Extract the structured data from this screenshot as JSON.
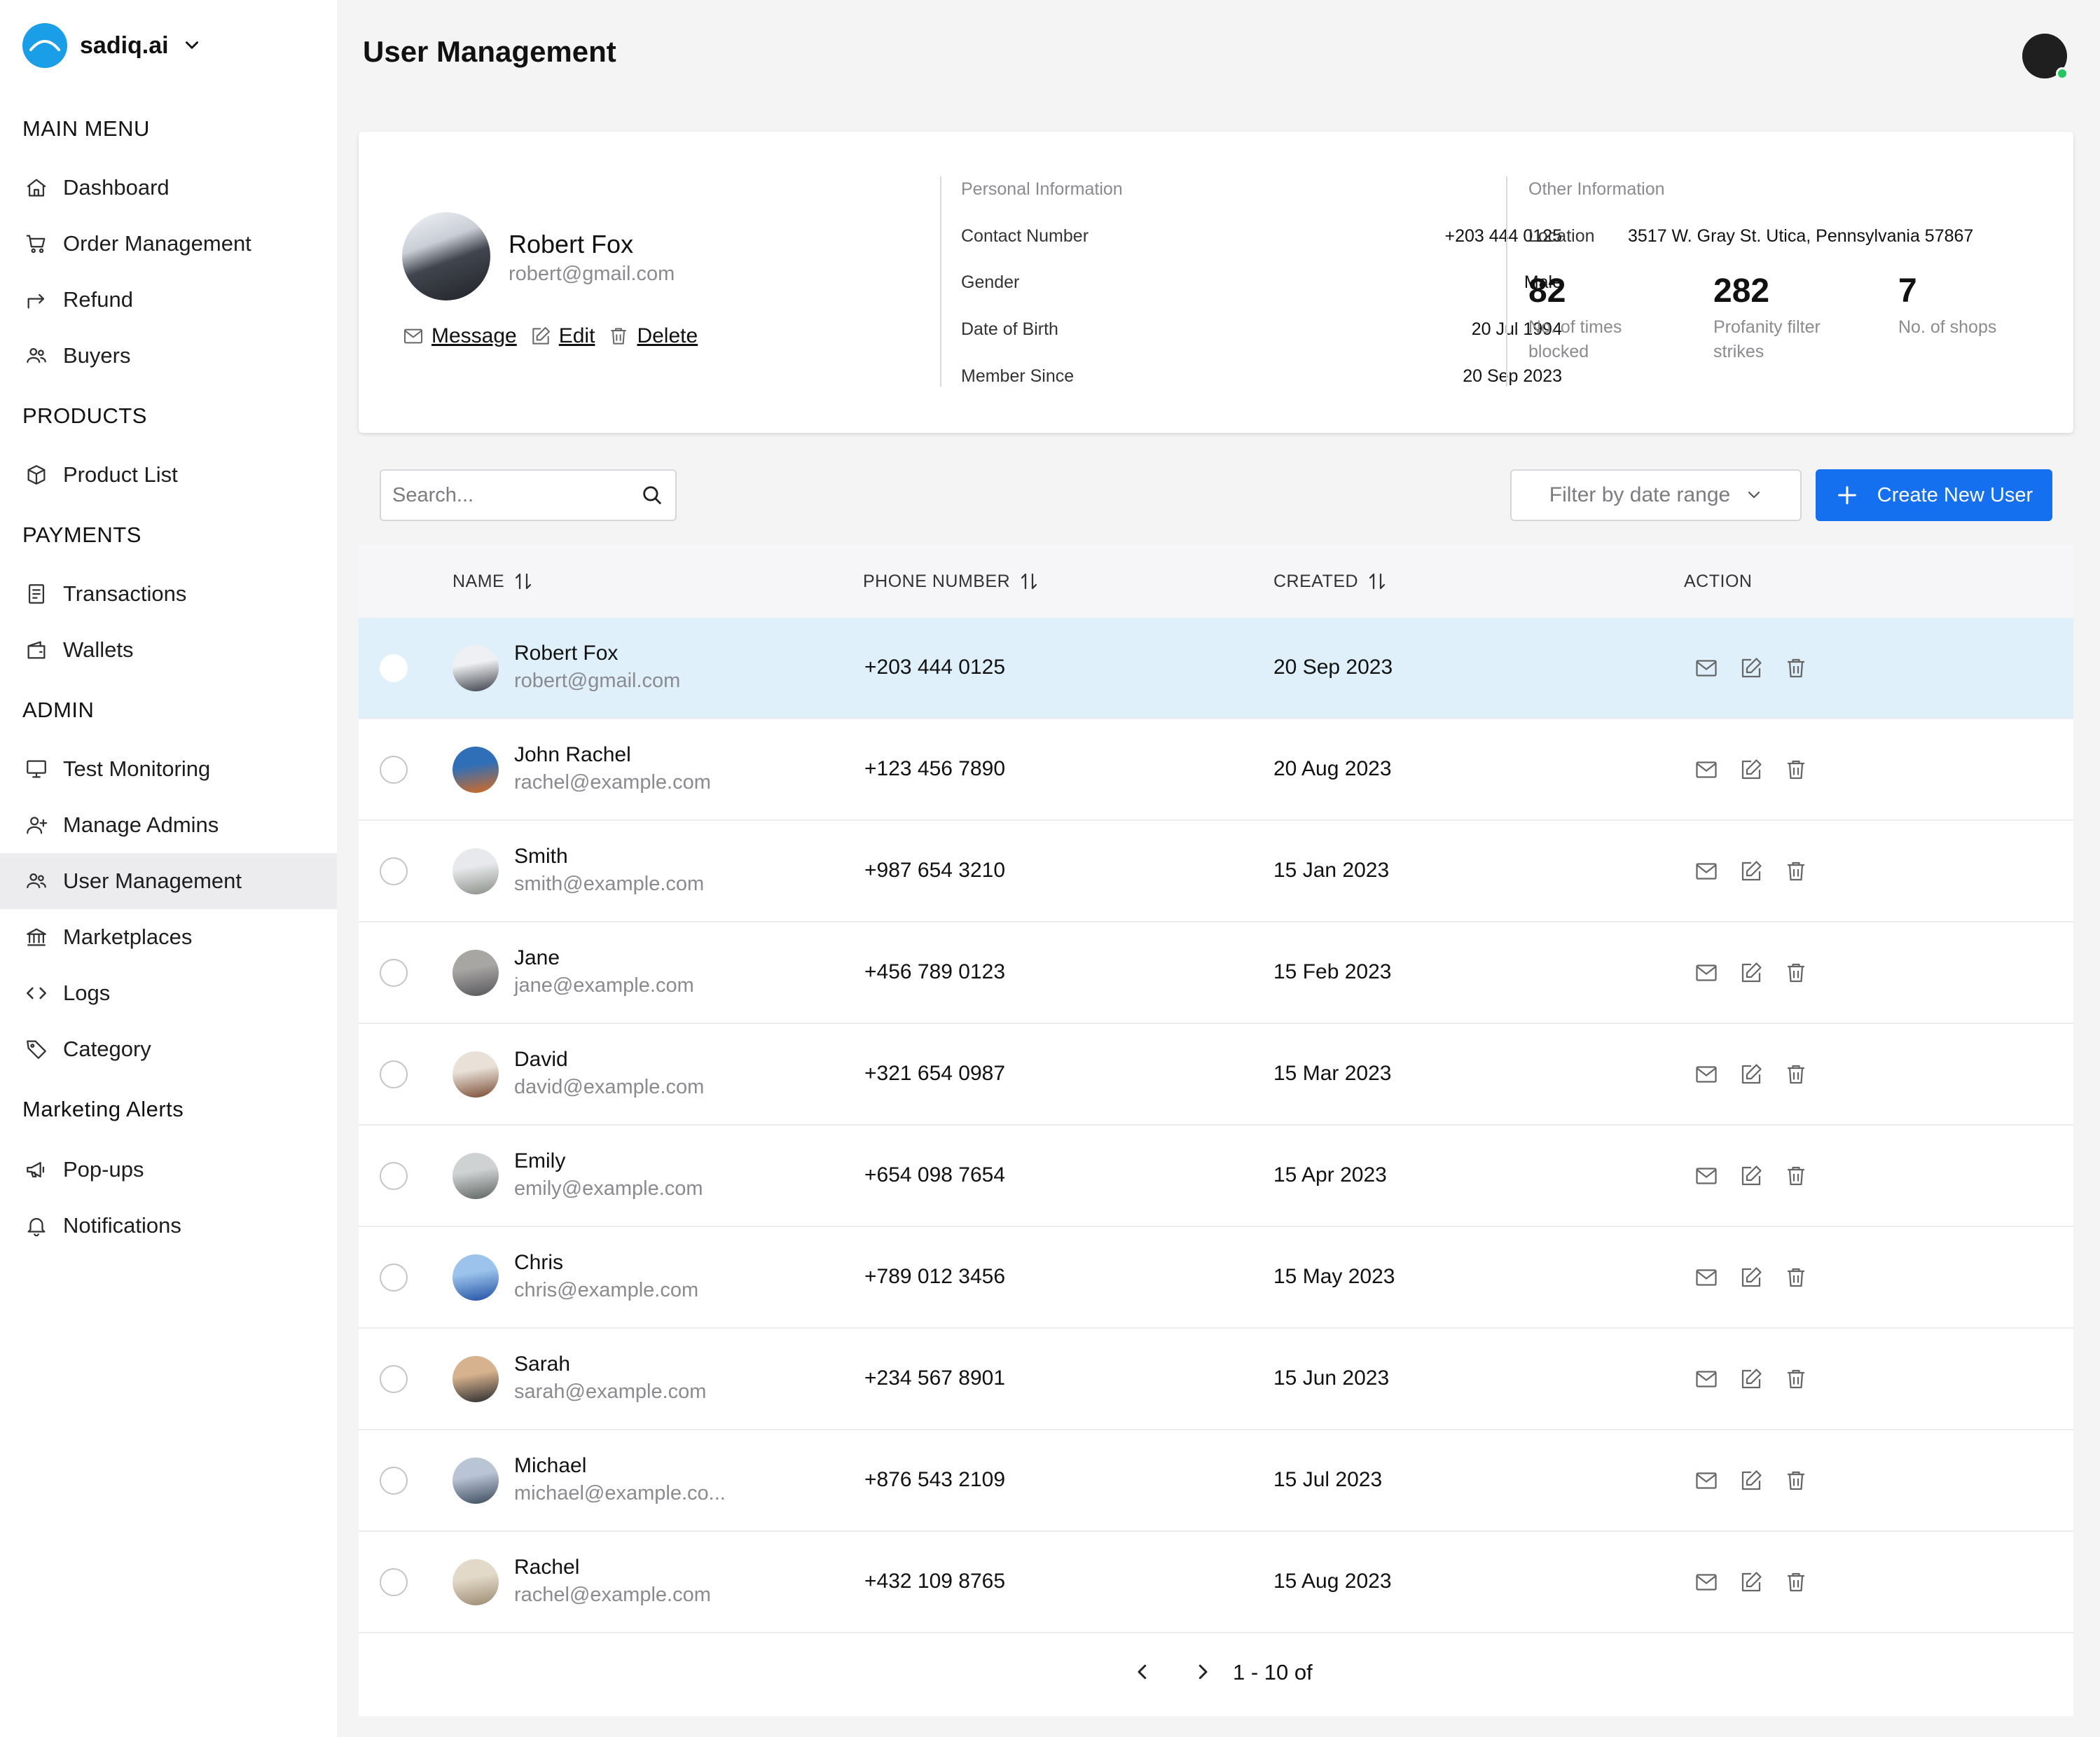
{
  "brand": {
    "name": "sadiq.ai"
  },
  "sidebar": {
    "sections": [
      {
        "title": "MAIN MENU",
        "items": [
          {
            "label": "Dashboard",
            "icon": "home-icon"
          },
          {
            "label": "Order Management",
            "icon": "cart-icon"
          },
          {
            "label": "Refund",
            "icon": "forward-arrow-icon"
          },
          {
            "label": "Buyers",
            "icon": "users-icon"
          }
        ]
      },
      {
        "title": "PRODUCTS",
        "items": [
          {
            "label": "Product List",
            "icon": "box-icon"
          }
        ]
      },
      {
        "title": "PAYMENTS",
        "items": [
          {
            "label": "Transactions",
            "icon": "receipt-icon"
          },
          {
            "label": "Wallets",
            "icon": "wallet-icon"
          }
        ]
      },
      {
        "title": "ADMIN",
        "items": [
          {
            "label": "Test Monitoring",
            "icon": "monitor-icon"
          },
          {
            "label": "Manage Admins",
            "icon": "user-plus-icon"
          },
          {
            "label": "User Management",
            "icon": "users-icon",
            "active": true
          },
          {
            "label": "Marketplaces",
            "icon": "bank-icon"
          },
          {
            "label": "Logs",
            "icon": "code-icon"
          },
          {
            "label": "Category",
            "icon": "tag-icon"
          }
        ]
      },
      {
        "title": "Marketing Alerts",
        "items": [
          {
            "label": "Pop-ups",
            "icon": "megaphone-icon"
          },
          {
            "label": "Notifications",
            "icon": "bell-icon"
          }
        ]
      }
    ]
  },
  "header": {
    "title": "User Management"
  },
  "profile": {
    "name": "Robert Fox",
    "email": "robert@gmail.com",
    "actions": {
      "message": "Message",
      "edit": "Edit",
      "delete": "Delete"
    },
    "personal": {
      "heading": "Personal Information",
      "rows": [
        {
          "label": "Contact Number",
          "value": "+203 444 0125"
        },
        {
          "label": "Gender",
          "value": "Male"
        },
        {
          "label": "Date of Birth",
          "value": "20 Jul 1994"
        },
        {
          "label": "Member Since",
          "value": "20 Sep 2023"
        }
      ]
    },
    "other": {
      "heading": "Other Information",
      "location_label": "Location",
      "location_value": "3517 W. Gray St. Utica, Pennsylvania 57867",
      "stats": [
        {
          "value": "82",
          "label_line1": "No. of times",
          "label_line2": "blocked"
        },
        {
          "value": "282",
          "label_line1": "Profanity filter",
          "label_line2": "strikes"
        },
        {
          "value": "7",
          "label_line1": "No. of shops",
          "label_line2": ""
        }
      ]
    }
  },
  "toolbar": {
    "search_placeholder": "Search...",
    "filter_label": "Filter by date range",
    "create_label": "Create New User"
  },
  "table": {
    "columns": {
      "name": "NAME",
      "phone": "PHONE NUMBER",
      "created": "CREATED",
      "action": "ACTION"
    },
    "rows": [
      {
        "name": "Robert Fox",
        "email": "robert@gmail.com",
        "phone": "+203 444 0125",
        "created": "20 Sep 2023",
        "selected": true,
        "avatar_colors": [
          "#eef0f3",
          "#3b3f47"
        ]
      },
      {
        "name": "John Rachel",
        "email": "rachel@example.com",
        "phone": "+123 456 7890",
        "created": "20 Aug 2023",
        "selected": false,
        "avatar_colors": [
          "#2f6fb8",
          "#d96a1e"
        ]
      },
      {
        "name": "Smith",
        "email": "smith@example.com",
        "phone": "+987 654 3210",
        "created": "15 Jan 2023",
        "selected": false,
        "avatar_colors": [
          "#e7e9ec",
          "#8a8f86"
        ]
      },
      {
        "name": "Jane",
        "email": "jane@example.com",
        "phone": "+456 789 0123",
        "created": "15 Feb 2023",
        "selected": false,
        "avatar_colors": [
          "#a8a6a3",
          "#56555a"
        ]
      },
      {
        "name": "David",
        "email": "david@example.com",
        "phone": "+321 654 0987",
        "created": "15 Mar 2023",
        "selected": false,
        "avatar_colors": [
          "#e9e1d8",
          "#7a4a32"
        ]
      },
      {
        "name": "Emily",
        "email": "emily@example.com",
        "phone": "+654 098 7654",
        "created": "15 Apr 2023",
        "selected": false,
        "avatar_colors": [
          "#cfd2d3",
          "#5d6461"
        ]
      },
      {
        "name": "Chris",
        "email": "chris@example.com",
        "phone": "+789 012 3456",
        "created": "15 May 2023",
        "selected": false,
        "avatar_colors": [
          "#9cc3ec",
          "#1f4fa3"
        ]
      },
      {
        "name": "Sarah",
        "email": "sarah@example.com",
        "phone": "+234 567 8901",
        "created": "15 Jun 2023",
        "selected": false,
        "avatar_colors": [
          "#d7b28e",
          "#2a2a2e"
        ]
      },
      {
        "name": "Michael",
        "email": "michael@example.co...",
        "phone": "+876 543 2109",
        "created": "15 Jul 2023",
        "selected": false,
        "avatar_colors": [
          "#b9c4d4",
          "#3b4a5e"
        ]
      },
      {
        "name": "Rachel",
        "email": "rachel@example.com",
        "phone": "+432 109 8765",
        "created": "15 Aug 2023",
        "selected": false,
        "avatar_colors": [
          "#e3d9c8",
          "#9b8a72"
        ]
      }
    ]
  },
  "pagination": {
    "range": "1 - 10 of"
  },
  "colors": {
    "accent": "#1570ef",
    "brand": "#1a9ee8",
    "selected_row": "#dff0fa",
    "online": "#22c55e"
  }
}
